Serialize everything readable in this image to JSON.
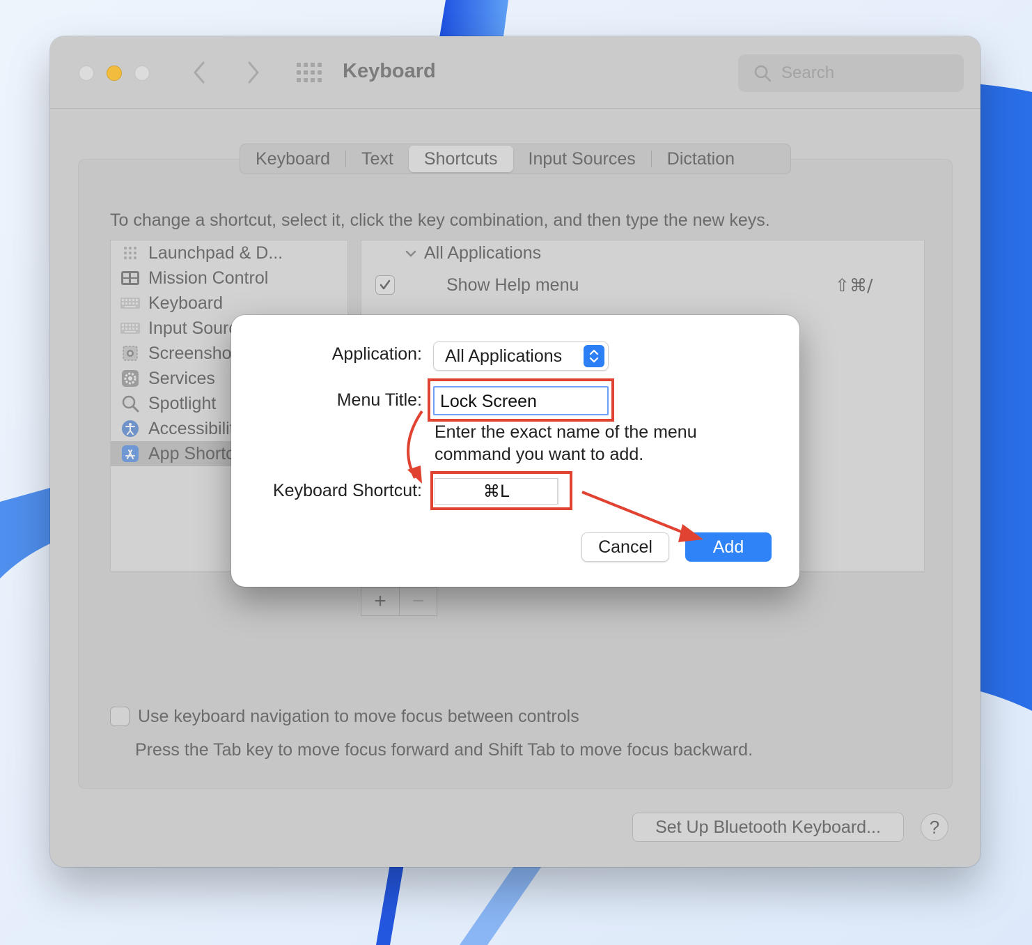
{
  "window": {
    "title": "Keyboard",
    "search_placeholder": "Search"
  },
  "tabs": [
    {
      "label": "Keyboard"
    },
    {
      "label": "Text"
    },
    {
      "label": "Shortcuts"
    },
    {
      "label": "Input Sources"
    },
    {
      "label": "Dictation"
    }
  ],
  "active_tab": "Shortcuts",
  "instruction": "To change a shortcut, select it, click the key combination, and then type the new keys.",
  "categories": [
    {
      "label": "Launchpad & D...",
      "icon": "launchpad-icon"
    },
    {
      "label": "Mission Control",
      "icon": "mission-control-icon"
    },
    {
      "label": "Keyboard",
      "icon": "keyboard-icon"
    },
    {
      "label": "Input Sources",
      "icon": "keyboard-icon"
    },
    {
      "label": "Screenshots",
      "icon": "screenshot-icon"
    },
    {
      "label": "Services",
      "icon": "gear-icon"
    },
    {
      "label": "Spotlight",
      "icon": "magnifier-icon"
    },
    {
      "label": "Accessibility",
      "icon": "accessibility-icon"
    },
    {
      "label": "App Shortcuts",
      "icon": "app-store-icon",
      "selected": true
    }
  ],
  "shortcuts": {
    "group_label": "All Applications",
    "rows": [
      {
        "name": "Show Help menu",
        "keys": "⇧⌘/",
        "enabled": true
      }
    ]
  },
  "plus_minus": {
    "plus": "+",
    "minus": "−"
  },
  "keyboard_navigation": {
    "label": "Use keyboard navigation to move focus between controls",
    "description": "Press the Tab key to move focus forward and Shift Tab to move focus backward.",
    "checked": false
  },
  "footer": {
    "bluetooth_button": "Set Up Bluetooth Keyboard...",
    "help_button": "?"
  },
  "sheet": {
    "application_label": "Application:",
    "application_value": "All Applications",
    "menu_title_label": "Menu Title:",
    "menu_title_value": "Lock Screen",
    "hint_line1": "Enter the exact name of the menu",
    "hint_line2": "command you want to add.",
    "shortcut_label": "Keyboard Shortcut:",
    "shortcut_value": "⌘L",
    "cancel_label": "Cancel",
    "add_label": "Add"
  },
  "colors": {
    "annotation_red": "#e04331",
    "accent_blue": "#2f83f6",
    "traffic_yellow": "#f2bd3f"
  }
}
